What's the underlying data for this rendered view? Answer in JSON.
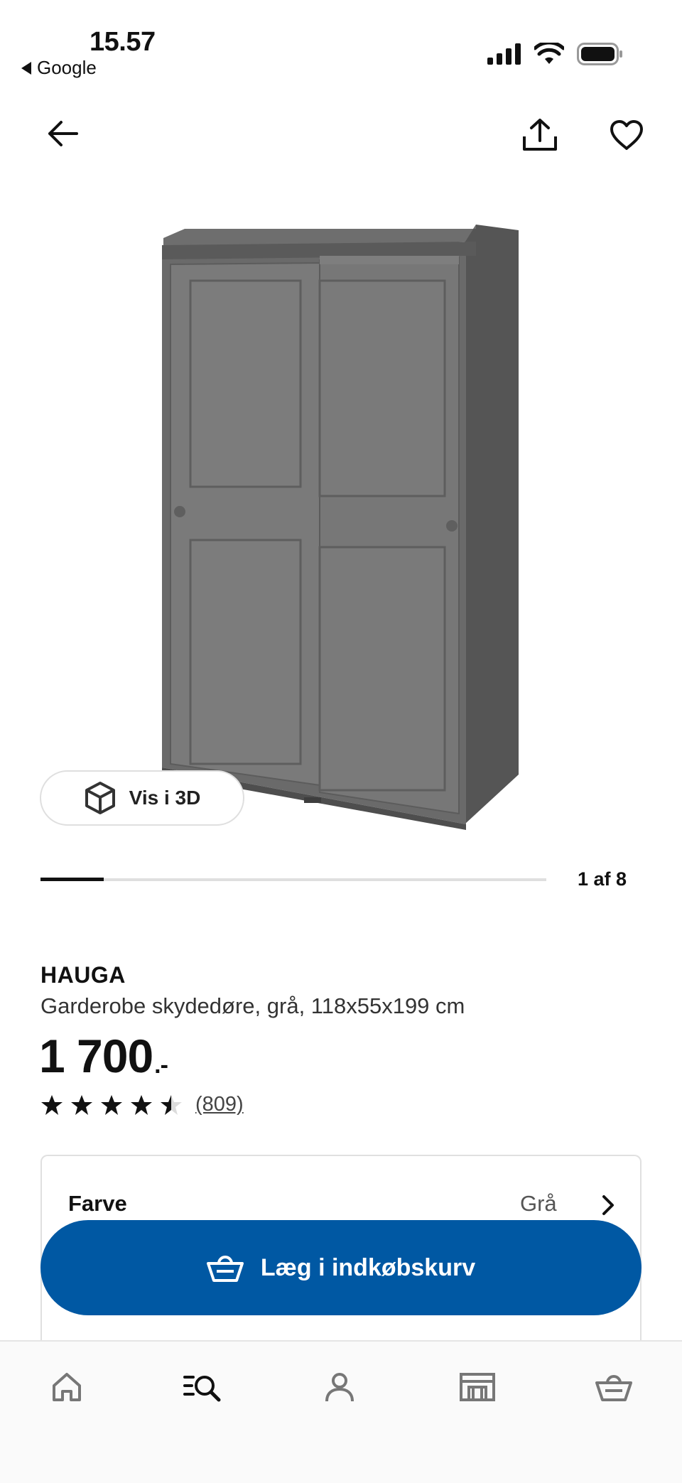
{
  "status_bar": {
    "time": "15.57",
    "back_app": "Google"
  },
  "top_nav": {
    "back_icon": "arrow-left-icon",
    "share_icon": "share-icon",
    "favorite_icon": "heart-icon"
  },
  "gallery": {
    "view_3d_label": "Vis i 3D",
    "counter": "1 af 8",
    "progress": 0.125
  },
  "product": {
    "brand": "HAUGA",
    "description": "Garderobe skydedøre, grå, 118x55x199 cm",
    "price": "1 700",
    "price_suffix": ".-",
    "rating": 4.5,
    "review_count": "(809)"
  },
  "options": {
    "color_label": "Farve",
    "color_value": "Grå"
  },
  "cart": {
    "button_label": "Læg i indkøbskurv"
  },
  "tabbar": {
    "items": [
      "home-icon",
      "search-icon",
      "profile-icon",
      "store-icon",
      "basket-icon"
    ]
  },
  "colors": {
    "accent": "#0058a3",
    "text": "#111111",
    "wardrobe": "#7a7a7a"
  }
}
